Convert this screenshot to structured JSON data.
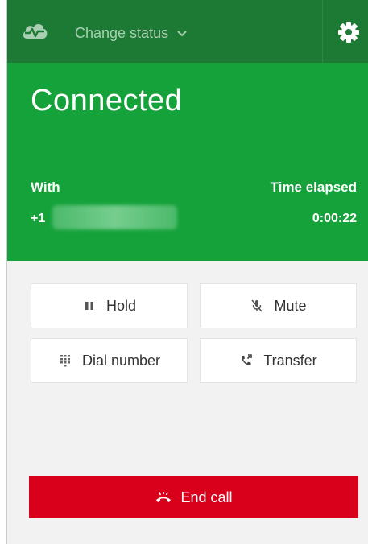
{
  "header": {
    "status_dropdown_label": "Change status",
    "logo_icon": "cloud-pulse-icon",
    "settings_icon": "gear-icon"
  },
  "call": {
    "state": "Connected",
    "with_label": "With",
    "phone_prefix": "+1",
    "elapsed_label": "Time elapsed",
    "elapsed_value": "0:00:22"
  },
  "actions": {
    "hold_label": "Hold",
    "mute_label": "Mute",
    "dial_label": "Dial number",
    "transfer_label": "Transfer",
    "end_call_label": "End call"
  },
  "colors": {
    "topbar": "#1d7a35",
    "connected_panel": "#16a23b",
    "end_call": "#d9001b",
    "background": "#f2f2f2"
  }
}
